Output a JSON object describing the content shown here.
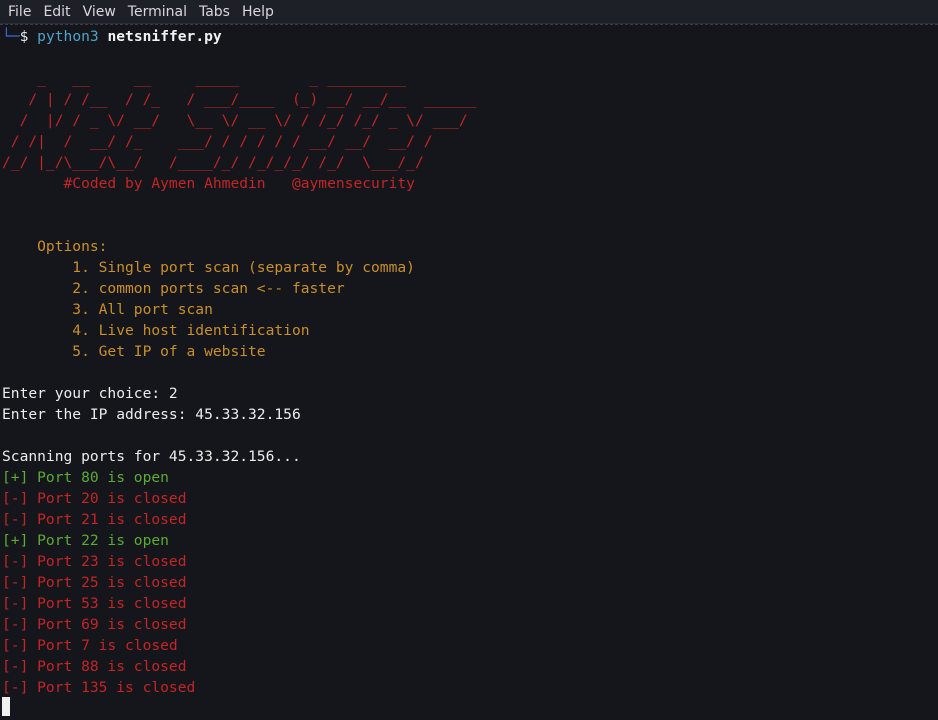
{
  "menu": [
    "File",
    "Edit",
    "View",
    "Terminal",
    "Tabs",
    "Help"
  ],
  "prompt": {
    "corner": "└─",
    "dollar": "$",
    "command": "python3",
    "file": "netsniffer.py"
  },
  "banner": [
    "    _   __     __     _____        _ _________",
    "   / | / /__  / /_   / ___/____  (_) __/ __/__  ______",
    "  /  |/ / _ \\/ __/   \\__ \\/ __ \\/ / /_/ /_/ _ \\/ ___/",
    " / /|  /  __/ /_    ___/ / / / / / __/ __/  __/ /",
    "/_/ |_/\\___/\\__/   /____/_/ /_/_/_/ /_/  \\___/_/"
  ],
  "credit": "       #Coded by Aymen Ahmedin   @aymensecurity",
  "options": {
    "title": "    Options:",
    "items": [
      "        1. Single port scan (separate by comma)",
      "        2. common ports scan <-- faster",
      "        3. All port scan",
      "        4. Live host identification",
      "        5. Get IP of a website"
    ]
  },
  "input": {
    "choice": "Enter your choice: 2",
    "ip": "Enter the IP address: 45.33.32.156"
  },
  "scanning": "Scanning ports for 45.33.32.156...",
  "results": [
    {
      "text": "[+] Port 80 is open",
      "status": "open"
    },
    {
      "text": "[-] Port 20 is closed",
      "status": "closed"
    },
    {
      "text": "[-] Port 21 is closed",
      "status": "closed"
    },
    {
      "text": "[+] Port 22 is open",
      "status": "open"
    },
    {
      "text": "[-] Port 23 is closed",
      "status": "closed"
    },
    {
      "text": "[-] Port 25 is closed",
      "status": "closed"
    },
    {
      "text": "[-] Port 53 is closed",
      "status": "closed"
    },
    {
      "text": "[-] Port 69 is closed",
      "status": "closed"
    },
    {
      "text": "[-] Port 7 is closed",
      "status": "closed"
    },
    {
      "text": "[-] Port 88 is closed",
      "status": "closed"
    },
    {
      "text": "[-] Port 135 is closed",
      "status": "closed"
    }
  ],
  "colors": {
    "background": "#14161c",
    "open": "#5bab34",
    "closed": "#c42525",
    "options": "#c98f2a",
    "banner": "#c42525"
  }
}
